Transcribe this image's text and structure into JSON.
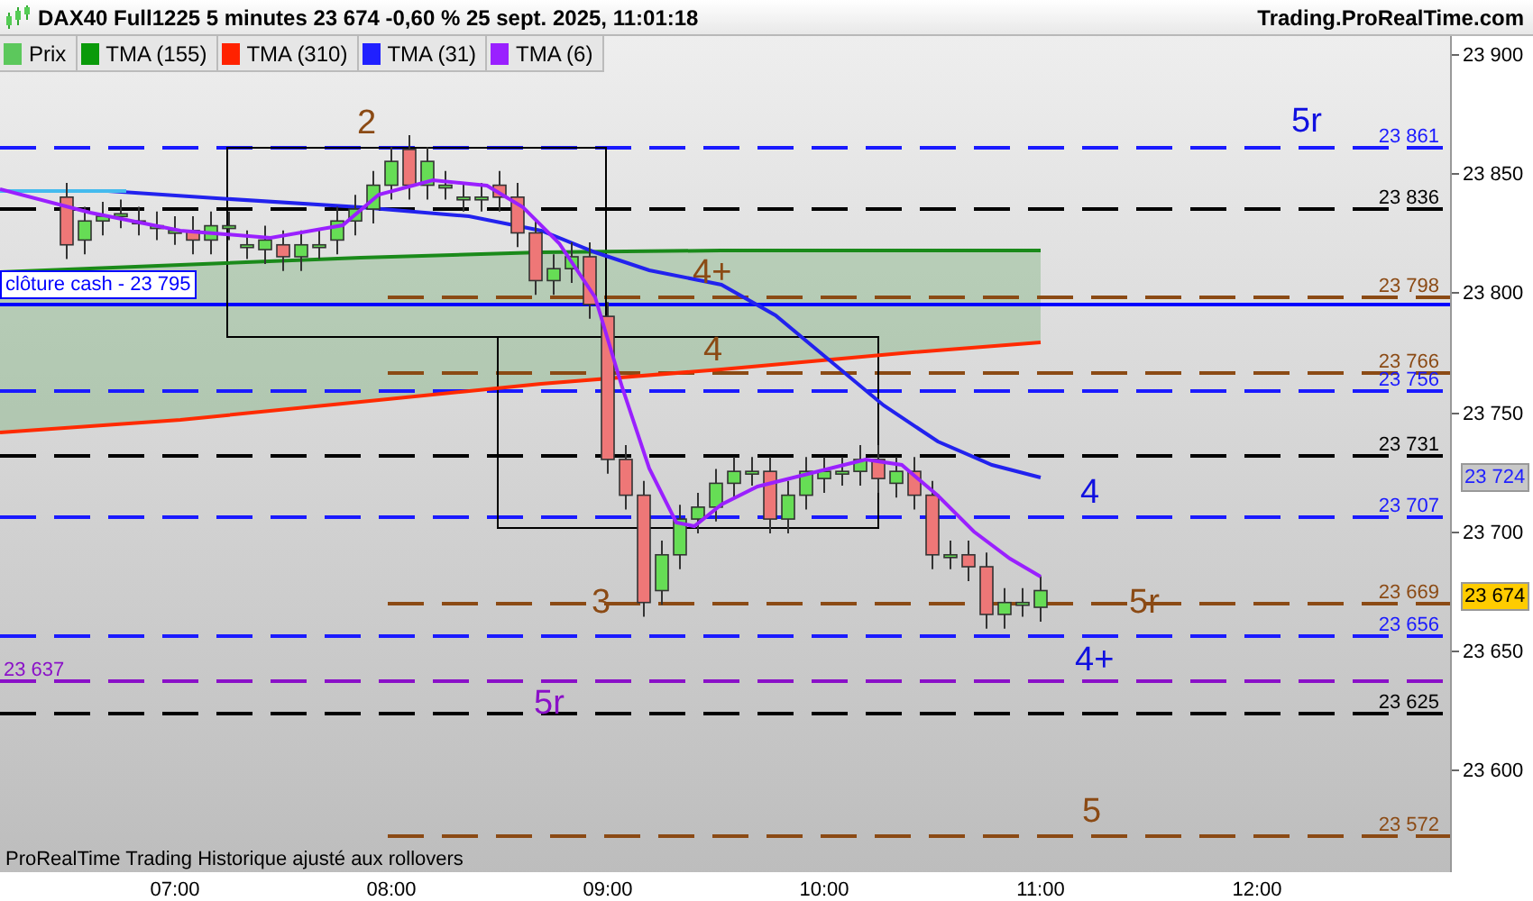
{
  "header": {
    "title": "DAX40 Full1225 5 minutes 23 674 -0,60 % 25 sept. 2025, 11:01:18",
    "site": "Trading.ProRealTime.com"
  },
  "legend": [
    {
      "label": "Prix",
      "color": "#5cc85c"
    },
    {
      "label": "TMA (155)",
      "color": "#0a9a0a"
    },
    {
      "label": "TMA (310)",
      "color": "#ff2200"
    },
    {
      "label": "TMA (31)",
      "color": "#2020ff"
    },
    {
      "label": "TMA (6)",
      "color": "#9a20ff"
    }
  ],
  "levels": [
    {
      "label": "23 861",
      "color": "#1a1aff"
    },
    {
      "label": "23 836",
      "color": "#000000"
    },
    {
      "label": "clôture cash -  23 795",
      "color": "#0000ff"
    },
    {
      "label": "23 798",
      "color": "#8b4a14"
    },
    {
      "label": "23 766",
      "color": "#8b4a14"
    },
    {
      "label": "23 756",
      "color": "#1a1aff"
    },
    {
      "label": "23 731",
      "color": "#000000"
    },
    {
      "label": "23 707",
      "color": "#1a1aff"
    },
    {
      "label": "23 669",
      "color": "#8b4a14"
    },
    {
      "label": "23 656",
      "color": "#1a1aff"
    },
    {
      "label": "23 637",
      "color": "#8a10c8"
    },
    {
      "label": "23 625",
      "color": "#000000"
    },
    {
      "label": "23 572",
      "color": "#8b4a14"
    }
  ],
  "wave_labels": [
    {
      "text": "2",
      "color": "#8b4a14"
    },
    {
      "text": "5r",
      "color": "#1010e0"
    },
    {
      "text": "4+",
      "color": "#8b4a14"
    },
    {
      "text": "4",
      "color": "#8b4a14"
    },
    {
      "text": "4",
      "color": "#1010e0"
    },
    {
      "text": "3",
      "color": "#8b4a14"
    },
    {
      "text": "5r",
      "color": "#8b4a14"
    },
    {
      "text": "4+",
      "color": "#1010e0"
    },
    {
      "text": "5r",
      "color": "#8a10c8"
    },
    {
      "text": "5",
      "color": "#8b4a14"
    }
  ],
  "price_axis": [
    "23 900",
    "23 850",
    "23 800",
    "23 750",
    "23 700",
    "23 650",
    "23 600"
  ],
  "axis_markers": [
    {
      "label": "23 724",
      "kind": "average"
    },
    {
      "label": "23 674",
      "kind": "last"
    }
  ],
  "time_axis": [
    "07:00",
    "08:00",
    "09:00",
    "10:00",
    "11:00",
    "12:00"
  ],
  "footer": "ProRealTime Trading  Historique ajusté aux rollovers"
}
